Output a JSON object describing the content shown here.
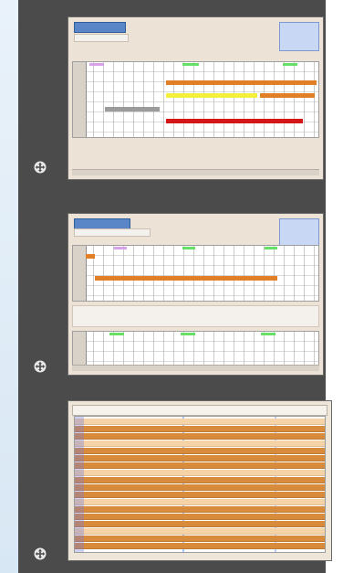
{
  "gallery": {
    "thumbnails": [
      {
        "title": "—"
      },
      {
        "title": "—"
      },
      {
        "title": ""
      }
    ]
  },
  "icons": {
    "move": "move-icon"
  }
}
